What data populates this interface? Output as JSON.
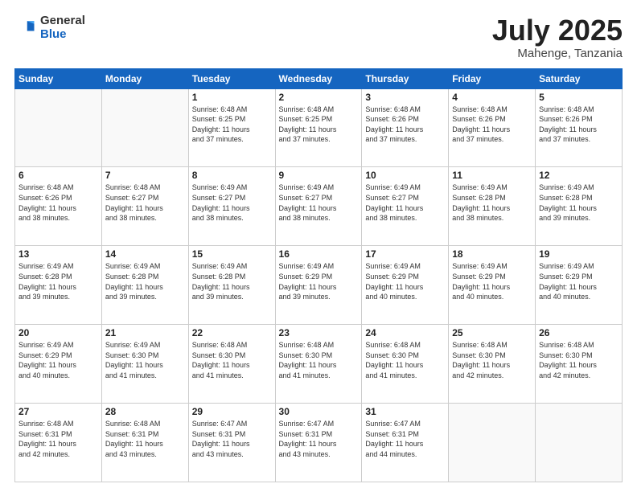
{
  "logo": {
    "general": "General",
    "blue": "Blue"
  },
  "title": "July 2025",
  "subtitle": "Mahenge, Tanzania",
  "days_of_week": [
    "Sunday",
    "Monday",
    "Tuesday",
    "Wednesday",
    "Thursday",
    "Friday",
    "Saturday"
  ],
  "weeks": [
    [
      {
        "day": "",
        "info": ""
      },
      {
        "day": "",
        "info": ""
      },
      {
        "day": "1",
        "info": "Sunrise: 6:48 AM\nSunset: 6:25 PM\nDaylight: 11 hours\nand 37 minutes."
      },
      {
        "day": "2",
        "info": "Sunrise: 6:48 AM\nSunset: 6:25 PM\nDaylight: 11 hours\nand 37 minutes."
      },
      {
        "day": "3",
        "info": "Sunrise: 6:48 AM\nSunset: 6:26 PM\nDaylight: 11 hours\nand 37 minutes."
      },
      {
        "day": "4",
        "info": "Sunrise: 6:48 AM\nSunset: 6:26 PM\nDaylight: 11 hours\nand 37 minutes."
      },
      {
        "day": "5",
        "info": "Sunrise: 6:48 AM\nSunset: 6:26 PM\nDaylight: 11 hours\nand 37 minutes."
      }
    ],
    [
      {
        "day": "6",
        "info": "Sunrise: 6:48 AM\nSunset: 6:26 PM\nDaylight: 11 hours\nand 38 minutes."
      },
      {
        "day": "7",
        "info": "Sunrise: 6:48 AM\nSunset: 6:27 PM\nDaylight: 11 hours\nand 38 minutes."
      },
      {
        "day": "8",
        "info": "Sunrise: 6:49 AM\nSunset: 6:27 PM\nDaylight: 11 hours\nand 38 minutes."
      },
      {
        "day": "9",
        "info": "Sunrise: 6:49 AM\nSunset: 6:27 PM\nDaylight: 11 hours\nand 38 minutes."
      },
      {
        "day": "10",
        "info": "Sunrise: 6:49 AM\nSunset: 6:27 PM\nDaylight: 11 hours\nand 38 minutes."
      },
      {
        "day": "11",
        "info": "Sunrise: 6:49 AM\nSunset: 6:28 PM\nDaylight: 11 hours\nand 38 minutes."
      },
      {
        "day": "12",
        "info": "Sunrise: 6:49 AM\nSunset: 6:28 PM\nDaylight: 11 hours\nand 39 minutes."
      }
    ],
    [
      {
        "day": "13",
        "info": "Sunrise: 6:49 AM\nSunset: 6:28 PM\nDaylight: 11 hours\nand 39 minutes."
      },
      {
        "day": "14",
        "info": "Sunrise: 6:49 AM\nSunset: 6:28 PM\nDaylight: 11 hours\nand 39 minutes."
      },
      {
        "day": "15",
        "info": "Sunrise: 6:49 AM\nSunset: 6:28 PM\nDaylight: 11 hours\nand 39 minutes."
      },
      {
        "day": "16",
        "info": "Sunrise: 6:49 AM\nSunset: 6:29 PM\nDaylight: 11 hours\nand 39 minutes."
      },
      {
        "day": "17",
        "info": "Sunrise: 6:49 AM\nSunset: 6:29 PM\nDaylight: 11 hours\nand 40 minutes."
      },
      {
        "day": "18",
        "info": "Sunrise: 6:49 AM\nSunset: 6:29 PM\nDaylight: 11 hours\nand 40 minutes."
      },
      {
        "day": "19",
        "info": "Sunrise: 6:49 AM\nSunset: 6:29 PM\nDaylight: 11 hours\nand 40 minutes."
      }
    ],
    [
      {
        "day": "20",
        "info": "Sunrise: 6:49 AM\nSunset: 6:29 PM\nDaylight: 11 hours\nand 40 minutes."
      },
      {
        "day": "21",
        "info": "Sunrise: 6:49 AM\nSunset: 6:30 PM\nDaylight: 11 hours\nand 41 minutes."
      },
      {
        "day": "22",
        "info": "Sunrise: 6:48 AM\nSunset: 6:30 PM\nDaylight: 11 hours\nand 41 minutes."
      },
      {
        "day": "23",
        "info": "Sunrise: 6:48 AM\nSunset: 6:30 PM\nDaylight: 11 hours\nand 41 minutes."
      },
      {
        "day": "24",
        "info": "Sunrise: 6:48 AM\nSunset: 6:30 PM\nDaylight: 11 hours\nand 41 minutes."
      },
      {
        "day": "25",
        "info": "Sunrise: 6:48 AM\nSunset: 6:30 PM\nDaylight: 11 hours\nand 42 minutes."
      },
      {
        "day": "26",
        "info": "Sunrise: 6:48 AM\nSunset: 6:30 PM\nDaylight: 11 hours\nand 42 minutes."
      }
    ],
    [
      {
        "day": "27",
        "info": "Sunrise: 6:48 AM\nSunset: 6:31 PM\nDaylight: 11 hours\nand 42 minutes."
      },
      {
        "day": "28",
        "info": "Sunrise: 6:48 AM\nSunset: 6:31 PM\nDaylight: 11 hours\nand 43 minutes."
      },
      {
        "day": "29",
        "info": "Sunrise: 6:47 AM\nSunset: 6:31 PM\nDaylight: 11 hours\nand 43 minutes."
      },
      {
        "day": "30",
        "info": "Sunrise: 6:47 AM\nSunset: 6:31 PM\nDaylight: 11 hours\nand 43 minutes."
      },
      {
        "day": "31",
        "info": "Sunrise: 6:47 AM\nSunset: 6:31 PM\nDaylight: 11 hours\nand 44 minutes."
      },
      {
        "day": "",
        "info": ""
      },
      {
        "day": "",
        "info": ""
      }
    ]
  ]
}
